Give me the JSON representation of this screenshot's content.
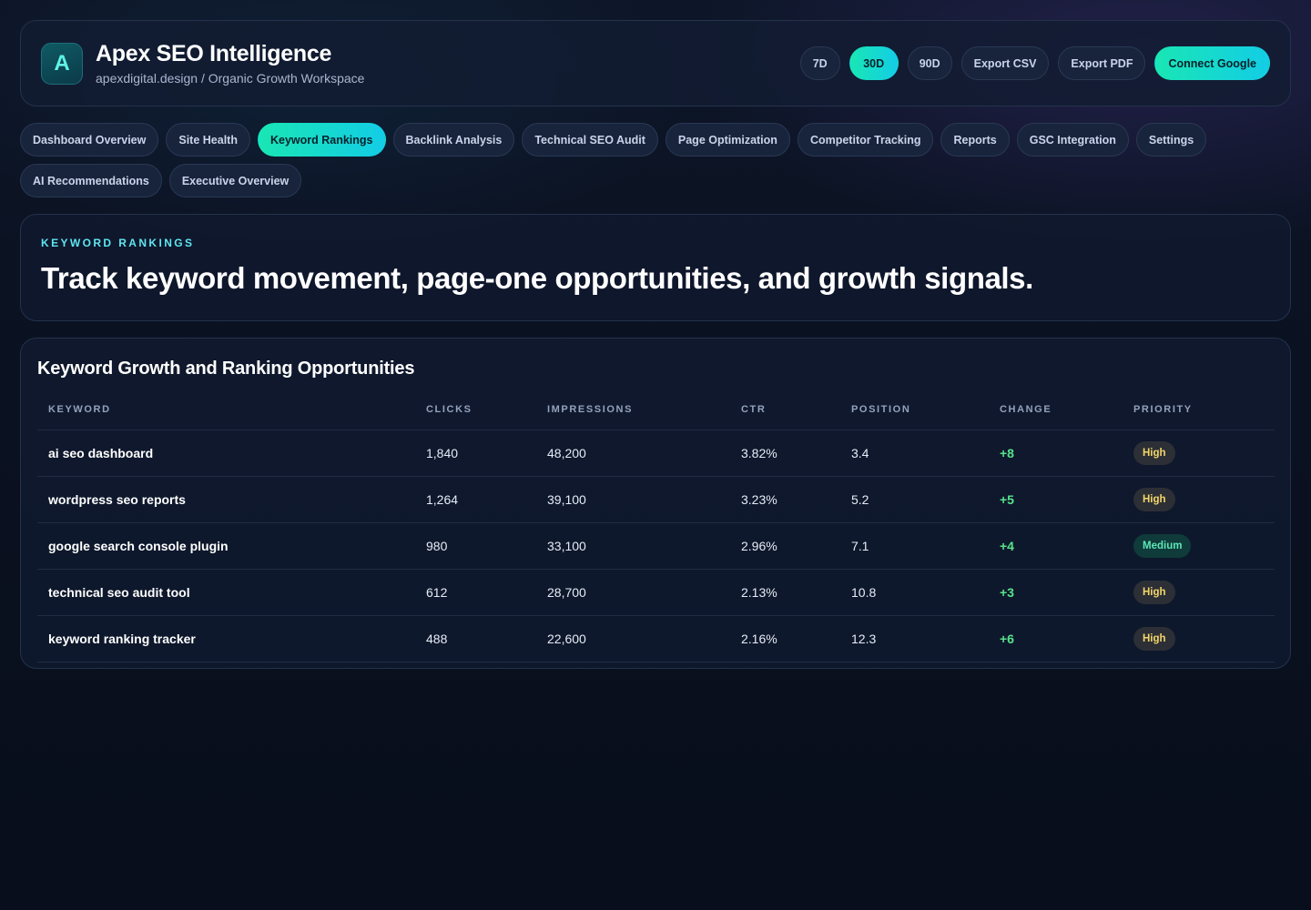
{
  "header": {
    "logo_letter": "A",
    "title": "Apex SEO Intelligence",
    "subtitle": "apexdigital.design / Organic Growth Workspace",
    "ranges": [
      "7D",
      "30D",
      "90D"
    ],
    "active_range": "30D",
    "export_csv": "Export CSV",
    "export_pdf": "Export PDF",
    "connect": "Connect Google"
  },
  "nav": {
    "active": "Keyword Rankings",
    "items": [
      "Dashboard Overview",
      "Site Health",
      "Keyword Rankings",
      "Backlink Analysis",
      "Technical SEO Audit",
      "Page Optimization",
      "Competitor Tracking",
      "Reports",
      "GSC Integration",
      "Settings",
      "AI Recommendations",
      "Executive Overview"
    ]
  },
  "hero": {
    "eyebrow": "KEYWORD RANKINGS",
    "title": "Track keyword movement, page-one opportunities, and growth signals."
  },
  "panel": {
    "title": "Keyword Growth and Ranking Opportunities",
    "columns": [
      "KEYWORD",
      "CLICKS",
      "IMPRESSIONS",
      "CTR",
      "POSITION",
      "CHANGE",
      "PRIORITY"
    ],
    "rows": [
      {
        "keyword": "ai seo dashboard",
        "clicks": "1,840",
        "impressions": "48,200",
        "ctr": "3.82%",
        "position": "3.4",
        "change": "+8",
        "priority": "High"
      },
      {
        "keyword": "wordpress seo reports",
        "clicks": "1,264",
        "impressions": "39,100",
        "ctr": "3.23%",
        "position": "5.2",
        "change": "+5",
        "priority": "High"
      },
      {
        "keyword": "google search console plugin",
        "clicks": "980",
        "impressions": "33,100",
        "ctr": "2.96%",
        "position": "7.1",
        "change": "+4",
        "priority": "Medium"
      },
      {
        "keyword": "technical seo audit tool",
        "clicks": "612",
        "impressions": "28,700",
        "ctr": "2.13%",
        "position": "10.8",
        "change": "+3",
        "priority": "High"
      },
      {
        "keyword": "keyword ranking tracker",
        "clicks": "488",
        "impressions": "22,600",
        "ctr": "2.16%",
        "position": "12.3",
        "change": "+6",
        "priority": "High"
      }
    ]
  },
  "colors": {
    "accent_start": "#19e6b4",
    "accent_end": "#13cde6",
    "positive_change": "#57e38b",
    "priority_high": "#f3d66b",
    "priority_medium": "#5de6b6"
  }
}
